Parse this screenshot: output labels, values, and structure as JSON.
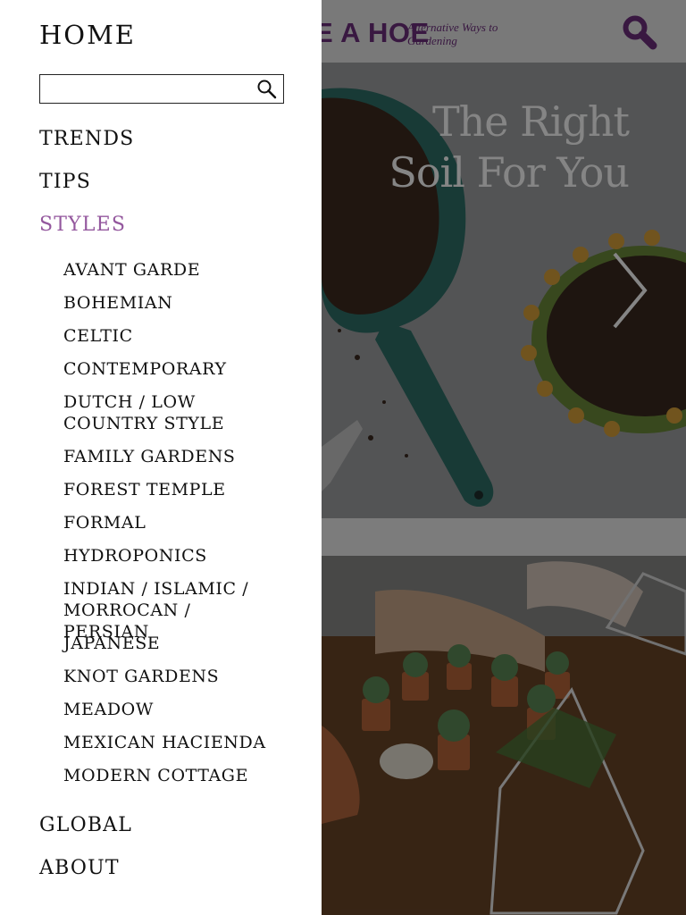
{
  "header": {
    "logo": "E A HOE",
    "tagline": "Alternative Ways to Gardening",
    "brand_color": "#6d2f7d"
  },
  "hero": {
    "title": "The Right Soil For You"
  },
  "drawer": {
    "home": "HOME",
    "search_placeholder": "",
    "nav": {
      "trends": "TRENDS",
      "tips": "TIPS",
      "styles": "STYLES",
      "global": "GLOBAL",
      "about": "ABOUT"
    },
    "active_color": "#94589e",
    "styles_sub": [
      "AVANT GARDE",
      "BOHEMIAN",
      "CELTIC",
      "CONTEMPORARY",
      "DUTCH / LOW COUNTRY STYLE",
      "FAMILY GARDENS",
      "FOREST TEMPLE",
      "FORMAL",
      "HYDROPONICS",
      "INDIAN / ISLAMIC / MORROCAN / PERSIAN",
      "JAPANESE",
      "KNOT GARDENS",
      "MEADOW",
      "MEXICAN HACIENDA",
      "MODERN COTTAGE"
    ]
  },
  "icons": {
    "search": "search-icon",
    "next": "chevron-right-icon"
  }
}
